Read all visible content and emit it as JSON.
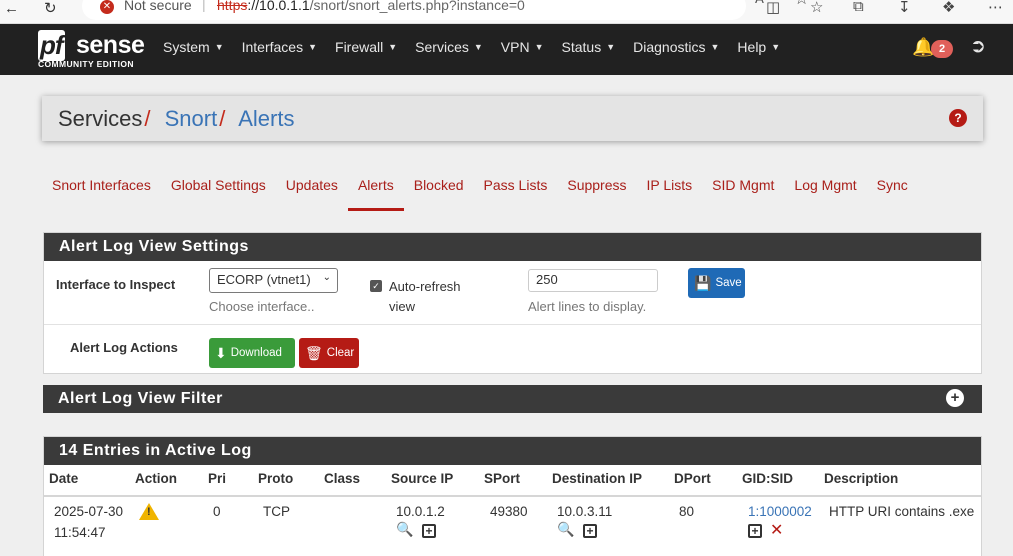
{
  "browser": {
    "security_label": "Not secure",
    "url_proto": "https",
    "url_host": "://10.0.1.1",
    "url_path": "/snort/snort_alerts.php?instance=0"
  },
  "nav": {
    "brand_sub": "COMMUNITY EDITION",
    "menu": [
      "System",
      "Interfaces",
      "Firewall",
      "Services",
      "VPN",
      "Status",
      "Diagnostics",
      "Help"
    ],
    "notification_count": "2"
  },
  "breadcrumb": {
    "part1": "Services",
    "part2": "Snort",
    "part3": "Alerts"
  },
  "tabs": [
    "Snort Interfaces",
    "Global Settings",
    "Updates",
    "Alerts",
    "Blocked",
    "Pass Lists",
    "Suppress",
    "IP Lists",
    "SID Mgmt",
    "Log Mgmt",
    "Sync"
  ],
  "settings": {
    "title": "Alert Log View Settings",
    "interface_label": "Interface to Inspect",
    "interface_value": "ECORP (vtnet1)",
    "interface_hint": "Choose interface..",
    "autorefresh_label": "Auto-refresh view",
    "alert_lines_value": "250",
    "alert_lines_hint": "Alert lines to display.",
    "save_label": "Save",
    "actions_label": "Alert Log Actions",
    "download_label": "Download",
    "clear_label": "Clear"
  },
  "filter": {
    "title": "Alert Log View Filter"
  },
  "log": {
    "title": "14 Entries in Active Log",
    "columns": [
      "Date",
      "Action",
      "Pri",
      "Proto",
      "Class",
      "Source IP",
      "SPort",
      "Destination IP",
      "DPort",
      "GID:SID",
      "Description"
    ],
    "rows": [
      {
        "date": "2025-07-30",
        "time": "11:54:47",
        "pri": "0",
        "proto": "TCP",
        "class": "",
        "source_ip": "10.0.1.2",
        "sport": "49380",
        "dest_ip": "10.0.3.11",
        "dport": "80",
        "gid_sid": "1:1000002",
        "description": "HTTP URI contains .exe"
      }
    ]
  }
}
